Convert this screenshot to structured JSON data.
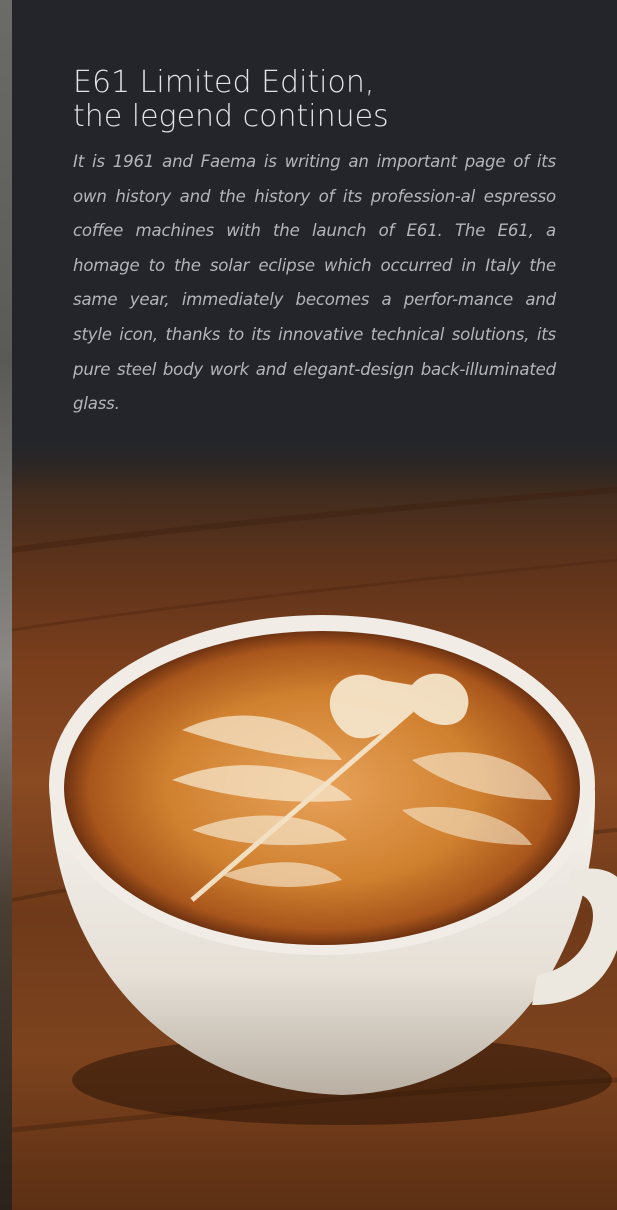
{
  "article": {
    "title_line1": "E61 Limited Edition,",
    "title_line2": "the legend continues",
    "body": "It is 1961 and Faema is writing an important page of its own history and the history of its profession-al espresso coffee machines with the launch of E61. The E61, a homage to the solar eclipse which occurred in Italy the same year, immediately becomes a perfor-mance and style icon, thanks to its innovative technical solutions, its pure steel body work and elegant-design back-illuminated glass."
  },
  "colors": {
    "panel_background": "#23252a",
    "title_color": "#e2e3e5",
    "body_color": "#b3b5b9",
    "wood": "#7a3e1c",
    "crema": "#c8742c",
    "cup": "#f2efe9"
  },
  "image": {
    "subject": "latte-art-cappuccino-cup-on-wooden-table"
  }
}
